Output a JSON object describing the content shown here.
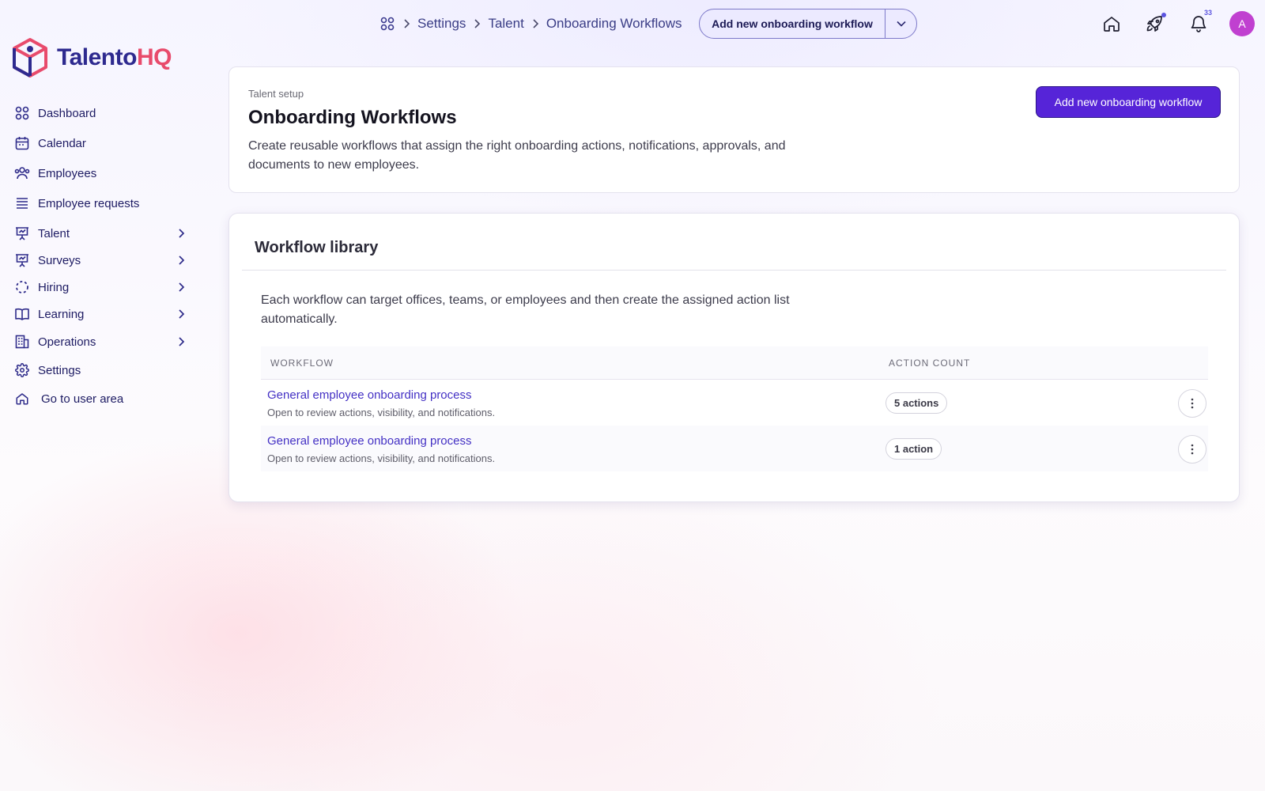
{
  "breadcrumb": {
    "items": [
      "Settings",
      "Talent",
      "Onboarding Workflows"
    ]
  },
  "topbar": {
    "split_button_label": "Add new onboarding workflow",
    "notification_count": "33",
    "avatar_initial": "A"
  },
  "logo": {
    "part1": "Talento",
    "part2": "HQ"
  },
  "sidebar": {
    "items": [
      {
        "label": "Dashboard",
        "icon": "dashboard-icon",
        "has_submenu": false
      },
      {
        "label": "Calendar",
        "icon": "calendar-icon",
        "has_submenu": false
      },
      {
        "label": "Employees",
        "icon": "users-icon",
        "has_submenu": false
      },
      {
        "label": "Employee requests",
        "icon": "list-icon",
        "has_submenu": false
      },
      {
        "label": "Talent",
        "icon": "presentation-icon",
        "has_submenu": true
      },
      {
        "label": "Surveys",
        "icon": "presentation-icon",
        "has_submenu": true
      },
      {
        "label": "Hiring",
        "icon": "dashed-circle-icon",
        "has_submenu": true
      },
      {
        "label": "Learning",
        "icon": "book-icon",
        "has_submenu": true
      },
      {
        "label": "Operations",
        "icon": "building-icon",
        "has_submenu": true
      },
      {
        "label": "Settings",
        "icon": "gear-icon",
        "has_submenu": false
      },
      {
        "label": "Go to user area",
        "icon": "home-icon",
        "has_submenu": false
      }
    ]
  },
  "header": {
    "eyebrow": "Talent setup",
    "title": "Onboarding Workflows",
    "description": "Create reusable workflows that assign the right onboarding actions, notifications, approvals, and documents to new employees.",
    "primary_button": "Add new onboarding workflow"
  },
  "library": {
    "title": "Workflow library",
    "description": "Each workflow can target offices, teams, or employees and then create the assigned action list automatically.",
    "columns": [
      "WORKFLOW",
      "ACTION COUNT"
    ],
    "rows": [
      {
        "name": "General employee onboarding process",
        "subtitle": "Open to review actions, visibility, and notifications.",
        "count": "5 actions"
      },
      {
        "name": "General employee onboarding process",
        "subtitle": "Open to review actions, visibility, and notifications.",
        "count": "1 action"
      }
    ]
  },
  "colors": {
    "brand_primary": "#5624d8",
    "brand_navy": "#2e2a8f",
    "brand_pink": "#e84b6c",
    "link": "#4330c4",
    "avatar": "#c040d0"
  }
}
